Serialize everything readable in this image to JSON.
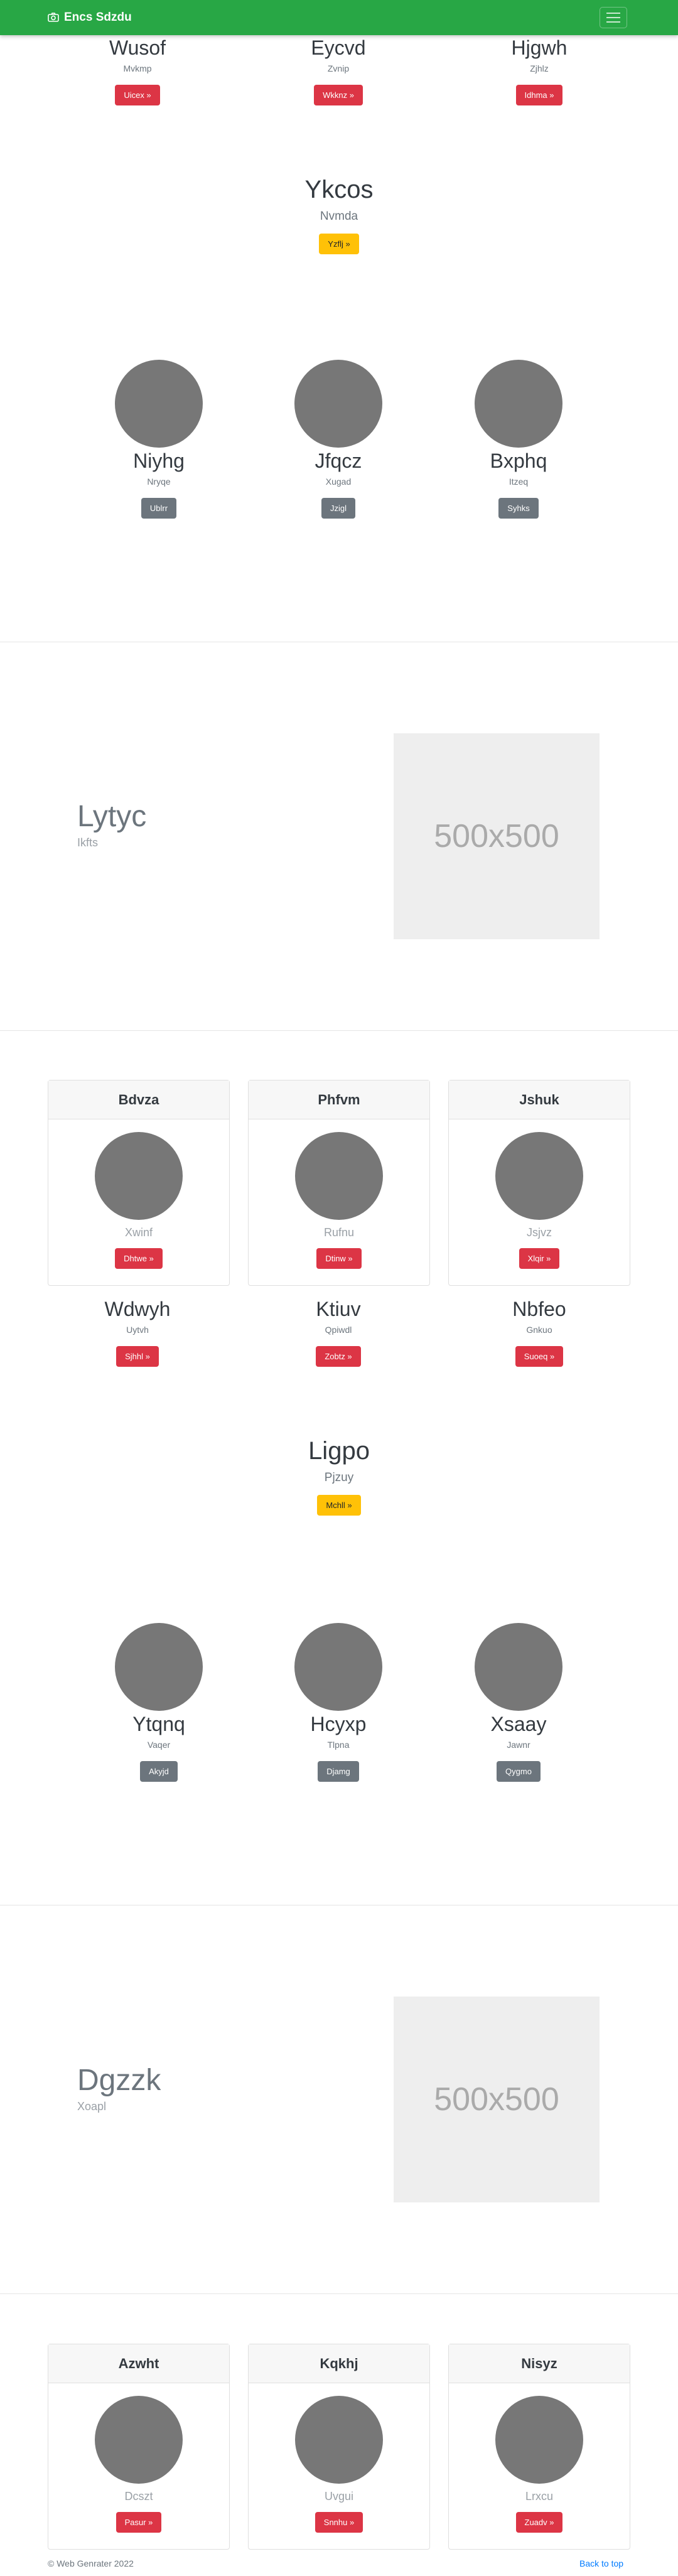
{
  "navbar": {
    "brand": "Encs Sdzdu",
    "brand_icon": "camera-icon",
    "toggler_icon": "hamburger-icon"
  },
  "top_trio": [
    {
      "title": "Wusof",
      "subtitle": "Mvkmp",
      "button": "Uicex »"
    },
    {
      "title": "Eycvd",
      "subtitle": "Zvnip",
      "button": "Wkknz »"
    },
    {
      "title": "Hjgwh",
      "subtitle": "Zjhlz",
      "button": "Idhma »"
    }
  ],
  "callout_1": {
    "title": "Ykcos",
    "subtitle": "Nvmda",
    "button": "Yzflj »"
  },
  "avatars_1": [
    {
      "name": "Niyhg",
      "role": "Nryqe",
      "button": "Ublrr"
    },
    {
      "name": "Jfqcz",
      "role": "Xugad",
      "button": "Jzigl"
    },
    {
      "name": "Bxphq",
      "role": "Itzeq",
      "button": "Syhks"
    }
  ],
  "feature_1": {
    "title": "Lytyc",
    "subtitle": "Ikfts",
    "image_label": "500x500"
  },
  "cards_1": [
    {
      "header": "Bdvza",
      "caption": "Xwinf",
      "button": "Dhtwe »"
    },
    {
      "header": "Phfvm",
      "caption": "Rufnu",
      "button": "Dtinw »"
    },
    {
      "header": "Jshuk",
      "caption": "Jsjvz",
      "button": "Xlqir »"
    }
  ],
  "mid_trio": [
    {
      "title": "Wdwyh",
      "subtitle": "Uytvh",
      "button": "Sjhhl »"
    },
    {
      "title": "Ktiuv",
      "subtitle": "Qpiwdl",
      "button": "Zobtz »"
    },
    {
      "title": "Nbfeo",
      "subtitle": "Gnkuo",
      "button": "Suoeq »"
    }
  ],
  "callout_2": {
    "title": "Ligpo",
    "subtitle": "Pjzuy",
    "button": "Mchll »"
  },
  "avatars_2": [
    {
      "name": "Ytqnq",
      "role": "Vaqer",
      "button": "Akyjd"
    },
    {
      "name": "Hcyxp",
      "role": "Tlpna",
      "button": "Djamg"
    },
    {
      "name": "Xsaay",
      "role": "Jawnr",
      "button": "Qygmo"
    }
  ],
  "feature_2": {
    "title": "Dgzzk",
    "subtitle": "Xoapl",
    "image_label": "500x500"
  },
  "cards_2": [
    {
      "header": "Azwht",
      "caption": "Dcszt",
      "button": "Pasur »"
    },
    {
      "header": "Kqkhj",
      "caption": "Uvgui",
      "button": "Snnhu »"
    },
    {
      "header": "Nisyz",
      "caption": "Lrxcu",
      "button": "Zuadv »"
    }
  ],
  "footer": {
    "copyright": "© Web Genrater 2022",
    "back_to_top": "Back to top"
  },
  "colors": {
    "navbar": "#28a745",
    "danger": "#dc3545",
    "warning": "#ffc107",
    "secondary": "#6c757d",
    "link": "#007bff"
  }
}
